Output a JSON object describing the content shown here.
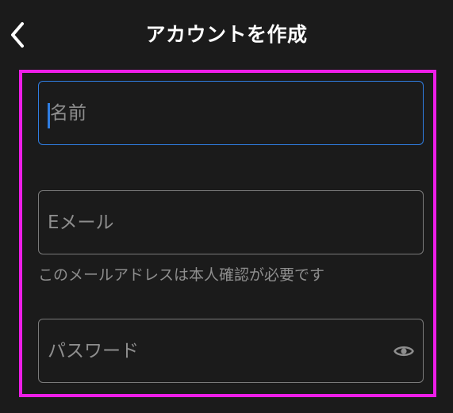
{
  "header": {
    "title": "アカウントを作成"
  },
  "form": {
    "name": {
      "placeholder": "名前",
      "value": ""
    },
    "email": {
      "placeholder": "Eメール",
      "value": "",
      "helper": "このメールアドレスは本人確認が必要です"
    },
    "password": {
      "placeholder": "パスワード",
      "value": ""
    }
  },
  "colors": {
    "background": "#1b1b1b",
    "focus": "#2f7de1",
    "highlight_border": "#ee1ee8"
  },
  "icons": {
    "back": "chevron-left-icon",
    "visibility": "eye-icon"
  }
}
